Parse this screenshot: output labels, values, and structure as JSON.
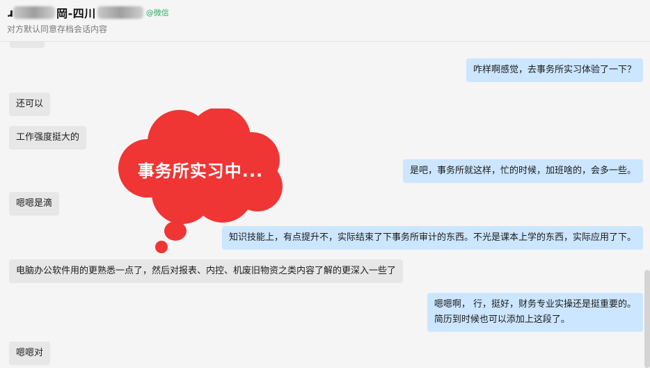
{
  "header": {
    "title_prefix": "ɹ",
    "title_main": "岡-四川",
    "wechat_tag": "@微信",
    "subtitle": "对方默认同意存档会话内容"
  },
  "messages": [
    {
      "side": "right",
      "text": "咋样啊感觉，去事务所实习体验了一下？"
    },
    {
      "side": "left",
      "text": "还可以"
    },
    {
      "side": "left",
      "text": "工作强度挺大的"
    },
    {
      "side": "right",
      "text": "是吧，事务所就这样，忙的时候，加班啥的，会多一些。"
    },
    {
      "side": "left",
      "text": "嗯嗯是滴"
    },
    {
      "side": "right",
      "text": "知识技能上，有点提升不，实际结束了下事务所审计的东西。不光是课本上学的东西，实际应用了下。"
    },
    {
      "side": "left",
      "text": "电脑办公软件用的更熟悉一点了，然后对报表、内控、机废旧物资之类内容了解的更深入一些了"
    },
    {
      "side": "right",
      "text": "嗯嗯啊， 行，挺好，财务专业实操还是挺重要的。",
      "text2": "简历到时候也可以添加上这段了。"
    },
    {
      "side": "left",
      "text": "嗯嗯对"
    }
  ],
  "overlay": {
    "text": "事务所实习中...",
    "color": "#f03535"
  }
}
